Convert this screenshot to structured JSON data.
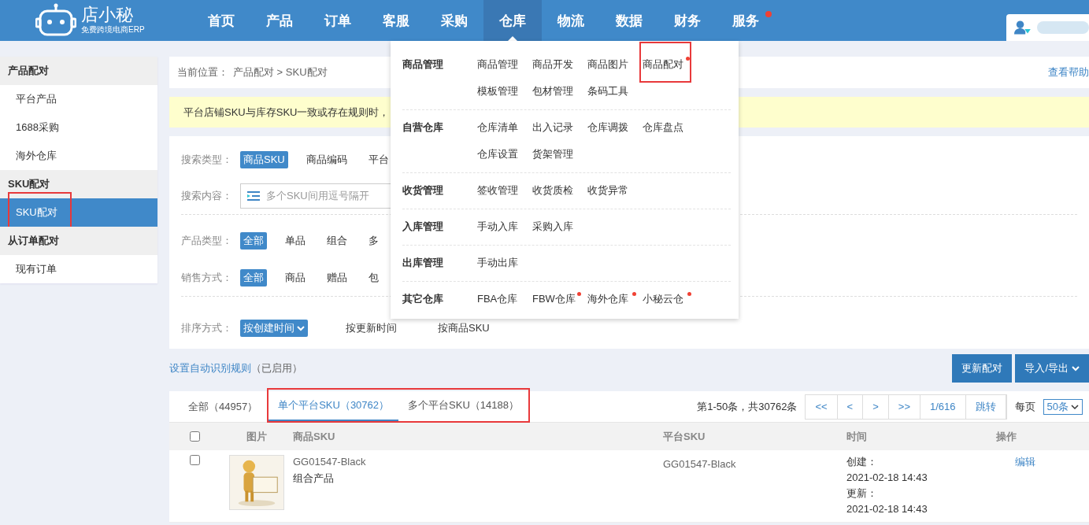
{
  "header": {
    "logo_text": "店小秘",
    "logo_subtitle": "免费跨境电商ERP",
    "nav": [
      {
        "label": "首页",
        "selected": false,
        "badge": false
      },
      {
        "label": "产品",
        "selected": false,
        "badge": false
      },
      {
        "label": "订单",
        "selected": false,
        "badge": false
      },
      {
        "label": "客服",
        "selected": false,
        "badge": false
      },
      {
        "label": "采购",
        "selected": false,
        "badge": false
      },
      {
        "label": "仓库",
        "selected": true,
        "badge": false
      },
      {
        "label": "物流",
        "selected": false,
        "badge": false
      },
      {
        "label": "数据",
        "selected": false,
        "badge": false
      },
      {
        "label": "财务",
        "selected": false,
        "badge": false
      },
      {
        "label": "服务",
        "selected": false,
        "badge": true
      }
    ]
  },
  "dropdown": {
    "groups": [
      {
        "title": "商品管理",
        "items": [
          {
            "label": "商品管理",
            "badge": false,
            "highlighted": false
          },
          {
            "label": "商品开发",
            "badge": false,
            "highlighted": false
          },
          {
            "label": "商品图片",
            "badge": false,
            "highlighted": false
          },
          {
            "label": "商品配对",
            "badge": true,
            "highlighted": true
          },
          {
            "label": "模板管理",
            "badge": false,
            "highlighted": false
          },
          {
            "label": "包材管理",
            "badge": false,
            "highlighted": false
          },
          {
            "label": "条码工具",
            "badge": false,
            "highlighted": false
          }
        ]
      },
      {
        "title": "自营仓库",
        "items": [
          {
            "label": "仓库清单",
            "badge": false,
            "highlighted": false
          },
          {
            "label": "出入记录",
            "badge": false,
            "highlighted": false
          },
          {
            "label": "仓库调拨",
            "badge": false,
            "highlighted": false
          },
          {
            "label": "仓库盘点",
            "badge": false,
            "highlighted": false
          },
          {
            "label": "仓库设置",
            "badge": false,
            "highlighted": false
          },
          {
            "label": "货架管理",
            "badge": false,
            "highlighted": false
          }
        ]
      },
      {
        "title": "收货管理",
        "items": [
          {
            "label": "签收管理",
            "badge": false,
            "highlighted": false
          },
          {
            "label": "收货质检",
            "badge": false,
            "highlighted": false
          },
          {
            "label": "收货异常",
            "badge": false,
            "highlighted": false
          }
        ]
      },
      {
        "title": "入库管理",
        "items": [
          {
            "label": "手动入库",
            "badge": false,
            "highlighted": false
          },
          {
            "label": "采购入库",
            "badge": false,
            "highlighted": false
          }
        ]
      },
      {
        "title": "出库管理",
        "items": [
          {
            "label": "手动出库",
            "badge": false,
            "highlighted": false
          }
        ]
      },
      {
        "title": "其它仓库",
        "items": [
          {
            "label": "FBA仓库",
            "badge": false,
            "highlighted": false
          },
          {
            "label": "FBW仓库",
            "badge": true,
            "highlighted": false
          },
          {
            "label": "海外仓库",
            "badge": true,
            "highlighted": false
          },
          {
            "label": "小秘云仓",
            "badge": true,
            "highlighted": false
          }
        ]
      }
    ]
  },
  "sidebar": {
    "sections": [
      {
        "title": "产品配对",
        "items": [
          {
            "label": "平台产品",
            "selected": false,
            "highlighted": false
          },
          {
            "label": "1688采购",
            "selected": false,
            "highlighted": false
          },
          {
            "label": "海外仓库",
            "selected": false,
            "highlighted": false
          }
        ]
      },
      {
        "title": "SKU配对",
        "items": [
          {
            "label": "SKU配对",
            "selected": true,
            "highlighted": true
          }
        ]
      },
      {
        "title": "从订单配对",
        "items": [
          {
            "label": "现有订单",
            "selected": false,
            "highlighted": false
          }
        ]
      }
    ]
  },
  "breadcrumb": {
    "prefix": "当前位置：",
    "path": "产品配对 > SKU配对",
    "help": "查看帮助"
  },
  "notice": "平台店铺SKU与库存SKU一致或存在规则时，",
  "filters": [
    {
      "label": "搜索类型：",
      "kind": "options",
      "options": [
        {
          "text": "商品SKU",
          "selected": true
        },
        {
          "text": "商品编码",
          "selected": false
        },
        {
          "text": "平台",
          "selected": false
        }
      ]
    },
    {
      "label": "搜索内容：",
      "kind": "search",
      "placeholder": "多个SKU间用逗号隔开"
    },
    {
      "label": "产品类型：",
      "kind": "options",
      "options": [
        {
          "text": "全部",
          "selected": true
        },
        {
          "text": "单品",
          "selected": false
        },
        {
          "text": "组合",
          "selected": false
        },
        {
          "text": "多",
          "selected": false
        }
      ]
    },
    {
      "label": "销售方式：",
      "kind": "options",
      "options": [
        {
          "text": "全部",
          "selected": true
        },
        {
          "text": "商品",
          "selected": false
        },
        {
          "text": "赠品",
          "selected": false
        },
        {
          "text": "包",
          "selected": false
        }
      ]
    },
    {
      "label": "排序方式：",
      "kind": "sort",
      "options": [
        {
          "text": "按创建时间",
          "selected": true
        },
        {
          "text": "按更新时间",
          "selected": false
        },
        {
          "text": "按商品SKU",
          "selected": false
        }
      ]
    }
  ],
  "rule_link": "设置自动识别规则",
  "rule_status": "（已启用）",
  "buttons": [
    "更新配对",
    "导入/导出"
  ],
  "tabs": [
    {
      "label": "全部（44957）",
      "selected": false,
      "highlighted": false
    },
    {
      "label": "单个平台SKU（30762）",
      "selected": true,
      "highlighted": true
    },
    {
      "label": "多个平台SKU（14188）",
      "selected": false,
      "highlighted": true
    }
  ],
  "pagination": {
    "summary": "第1-50条，共30762条",
    "buttons": [
      "<<",
      "<",
      ">",
      ">>",
      "1/616",
      "跳转"
    ],
    "per_page_label": "每页",
    "per_page": "50条"
  },
  "table": {
    "select_all_checked": false,
    "columns": [
      "图片",
      "商品SKU",
      "平台SKU",
      "时间",
      "操作"
    ],
    "rows": [
      {
        "checked": false,
        "sku": "GG01547-Black",
        "type": "组合产品",
        "platform_sku": "GG01547-Black",
        "created_label": "创建：",
        "created": "2021-02-18 14:43",
        "updated_label": "更新：",
        "updated": "2021-02-18 14:43",
        "action": "编辑"
      }
    ]
  }
}
